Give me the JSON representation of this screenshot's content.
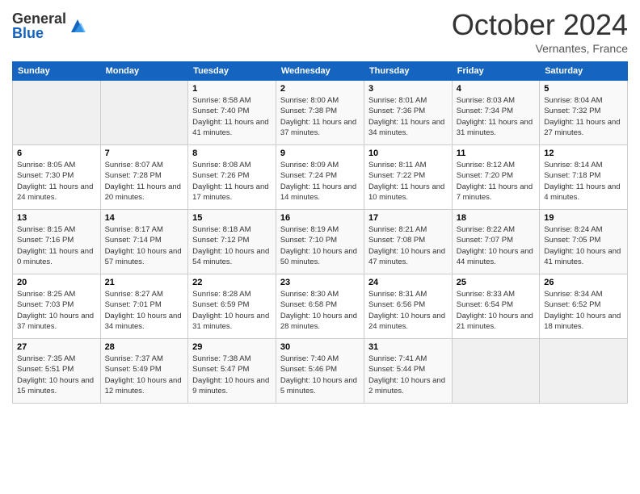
{
  "header": {
    "logo_general": "General",
    "logo_blue": "Blue",
    "month": "October 2024",
    "location": "Vernantes, France"
  },
  "weekdays": [
    "Sunday",
    "Monday",
    "Tuesday",
    "Wednesday",
    "Thursday",
    "Friday",
    "Saturday"
  ],
  "weeks": [
    [
      {
        "empty": true
      },
      {
        "empty": true
      },
      {
        "day": 1,
        "sunrise": "8:58 AM",
        "sunset": "7:40 PM",
        "daylight": "11 hours and 41 minutes."
      },
      {
        "day": 2,
        "sunrise": "8:00 AM",
        "sunset": "7:38 PM",
        "daylight": "11 hours and 37 minutes."
      },
      {
        "day": 3,
        "sunrise": "8:01 AM",
        "sunset": "7:36 PM",
        "daylight": "11 hours and 34 minutes."
      },
      {
        "day": 4,
        "sunrise": "8:03 AM",
        "sunset": "7:34 PM",
        "daylight": "11 hours and 31 minutes."
      },
      {
        "day": 5,
        "sunrise": "8:04 AM",
        "sunset": "7:32 PM",
        "daylight": "11 hours and 27 minutes."
      }
    ],
    [
      {
        "day": 6,
        "sunrise": "8:05 AM",
        "sunset": "7:30 PM",
        "daylight": "11 hours and 24 minutes."
      },
      {
        "day": 7,
        "sunrise": "8:07 AM",
        "sunset": "7:28 PM",
        "daylight": "11 hours and 20 minutes."
      },
      {
        "day": 8,
        "sunrise": "8:08 AM",
        "sunset": "7:26 PM",
        "daylight": "11 hours and 17 minutes."
      },
      {
        "day": 9,
        "sunrise": "8:09 AM",
        "sunset": "7:24 PM",
        "daylight": "11 hours and 14 minutes."
      },
      {
        "day": 10,
        "sunrise": "8:11 AM",
        "sunset": "7:22 PM",
        "daylight": "11 hours and 10 minutes."
      },
      {
        "day": 11,
        "sunrise": "8:12 AM",
        "sunset": "7:20 PM",
        "daylight": "11 hours and 7 minutes."
      },
      {
        "day": 12,
        "sunrise": "8:14 AM",
        "sunset": "7:18 PM",
        "daylight": "11 hours and 4 minutes."
      }
    ],
    [
      {
        "day": 13,
        "sunrise": "8:15 AM",
        "sunset": "7:16 PM",
        "daylight": "11 hours and 0 minutes."
      },
      {
        "day": 14,
        "sunrise": "8:17 AM",
        "sunset": "7:14 PM",
        "daylight": "10 hours and 57 minutes."
      },
      {
        "day": 15,
        "sunrise": "8:18 AM",
        "sunset": "7:12 PM",
        "daylight": "10 hours and 54 minutes."
      },
      {
        "day": 16,
        "sunrise": "8:19 AM",
        "sunset": "7:10 PM",
        "daylight": "10 hours and 50 minutes."
      },
      {
        "day": 17,
        "sunrise": "8:21 AM",
        "sunset": "7:08 PM",
        "daylight": "10 hours and 47 minutes."
      },
      {
        "day": 18,
        "sunrise": "8:22 AM",
        "sunset": "7:07 PM",
        "daylight": "10 hours and 44 minutes."
      },
      {
        "day": 19,
        "sunrise": "8:24 AM",
        "sunset": "7:05 PM",
        "daylight": "10 hours and 41 minutes."
      }
    ],
    [
      {
        "day": 20,
        "sunrise": "8:25 AM",
        "sunset": "7:03 PM",
        "daylight": "10 hours and 37 minutes."
      },
      {
        "day": 21,
        "sunrise": "8:27 AM",
        "sunset": "7:01 PM",
        "daylight": "10 hours and 34 minutes."
      },
      {
        "day": 22,
        "sunrise": "8:28 AM",
        "sunset": "6:59 PM",
        "daylight": "10 hours and 31 minutes."
      },
      {
        "day": 23,
        "sunrise": "8:30 AM",
        "sunset": "6:58 PM",
        "daylight": "10 hours and 28 minutes."
      },
      {
        "day": 24,
        "sunrise": "8:31 AM",
        "sunset": "6:56 PM",
        "daylight": "10 hours and 24 minutes."
      },
      {
        "day": 25,
        "sunrise": "8:33 AM",
        "sunset": "6:54 PM",
        "daylight": "10 hours and 21 minutes."
      },
      {
        "day": 26,
        "sunrise": "8:34 AM",
        "sunset": "6:52 PM",
        "daylight": "10 hours and 18 minutes."
      }
    ],
    [
      {
        "day": 27,
        "sunrise": "7:35 AM",
        "sunset": "5:51 PM",
        "daylight": "10 hours and 15 minutes."
      },
      {
        "day": 28,
        "sunrise": "7:37 AM",
        "sunset": "5:49 PM",
        "daylight": "10 hours and 12 minutes."
      },
      {
        "day": 29,
        "sunrise": "7:38 AM",
        "sunset": "5:47 PM",
        "daylight": "10 hours and 9 minutes."
      },
      {
        "day": 30,
        "sunrise": "7:40 AM",
        "sunset": "5:46 PM",
        "daylight": "10 hours and 5 minutes."
      },
      {
        "day": 31,
        "sunrise": "7:41 AM",
        "sunset": "5:44 PM",
        "daylight": "10 hours and 2 minutes."
      },
      {
        "empty": true
      },
      {
        "empty": true
      }
    ]
  ]
}
